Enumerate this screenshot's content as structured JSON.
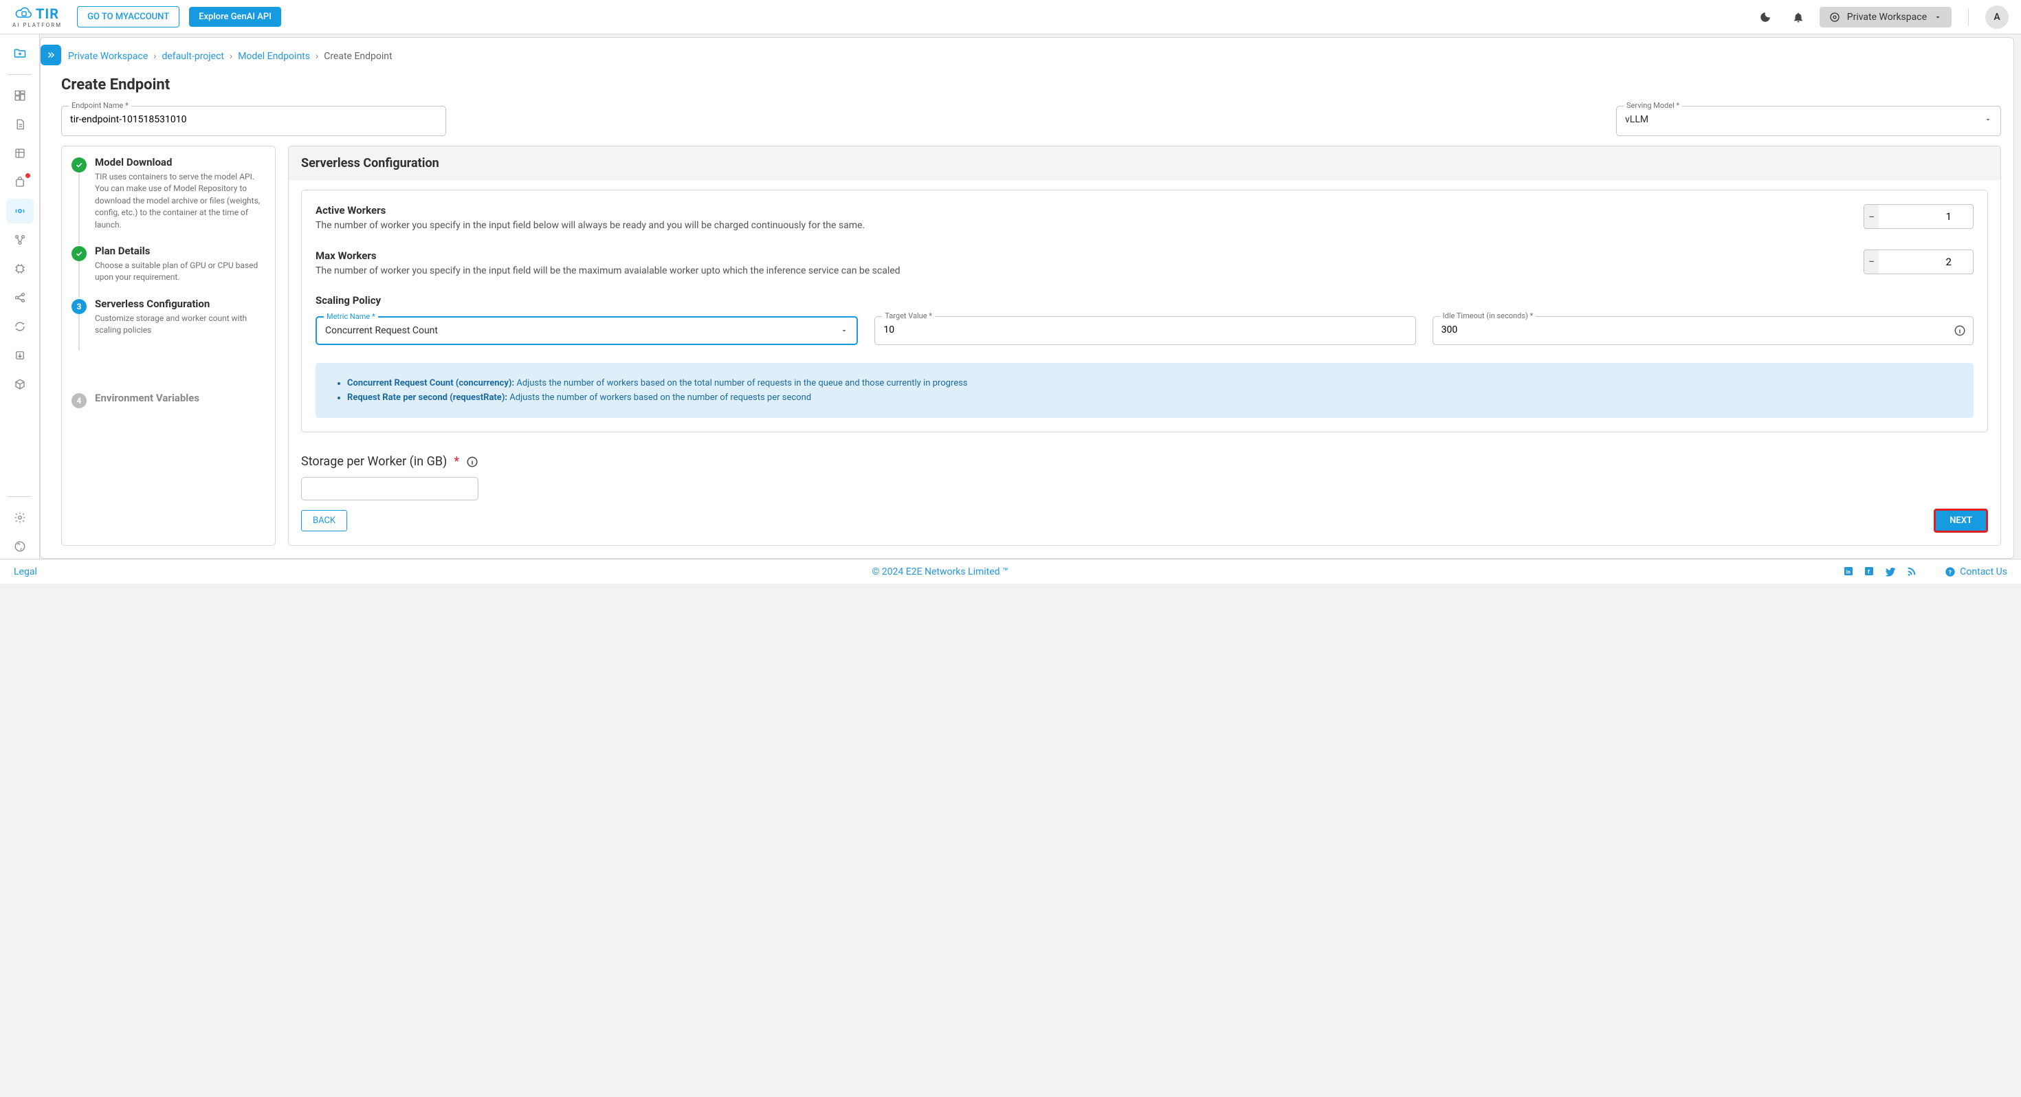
{
  "header": {
    "logo_text": "TIR",
    "logo_subtext": "AI PLATFORM",
    "myaccount_btn": "GO TO MYACCOUNT",
    "explore_btn": "Explore GenAI API",
    "workspace_label": "Private Workspace",
    "avatar_initial": "A"
  },
  "breadcrumb": {
    "items": [
      "Private Workspace",
      "default-project",
      "Model Endpoints"
    ],
    "current": "Create Endpoint"
  },
  "page_title": "Create Endpoint",
  "form": {
    "endpoint_name_label": "Endpoint Name *",
    "endpoint_name_value": "tir-endpoint-101518531010",
    "serving_model_label": "Serving Model *",
    "serving_model_value": "vLLM"
  },
  "stepper": [
    {
      "state": "done",
      "title": "Model Download",
      "desc": "TIR uses containers to serve the model API. You can make use of Model Repository to download the model archive or files (weights, config, etc.) to the container at the time of launch."
    },
    {
      "state": "done",
      "title": "Plan Details",
      "desc": "Choose a suitable plan of GPU or CPU based upon your requirement."
    },
    {
      "state": "active",
      "title": "Serverless Configuration",
      "num": "3",
      "desc": "Customize storage and worker count with scaling policies"
    },
    {
      "state": "pending",
      "title": "Environment Variables",
      "num": "4",
      "desc": ""
    }
  ],
  "config": {
    "heading": "Serverless Configuration",
    "active_workers": {
      "title": "Active Workers",
      "desc": "The number of worker you specify in the input field below will always be ready and you will be charged continuously for the same.",
      "value": "1"
    },
    "max_workers": {
      "title": "Max Workers",
      "desc": "The number of worker you specify in the input field will be the maximum avaialable worker upto which the inference service can be scaled",
      "value": "2"
    },
    "scaling_heading": "Scaling Policy",
    "metric_label": "Metric Name *",
    "metric_value": "Concurrent Request Count",
    "target_label": "Target Value *",
    "target_value": "10",
    "idle_label": "Idle Timeout (in seconds) *",
    "idle_value": "300",
    "note1_bold": "Concurrent Request Count (concurrency):",
    "note1_rest": " Adjusts the number of workers based on the total number of requests in the queue and those currently in progress",
    "note2_bold": "Request Rate per second (requestRate):",
    "note2_rest": " Adjusts the number of workers based on the number of requests per second",
    "storage_label": "Storage per Worker (in GB)",
    "back_btn": "BACK",
    "next_btn": "NEXT"
  },
  "footer": {
    "legal": "Legal",
    "copyright": "© 2024 E2E Networks Limited ™",
    "contact": "Contact Us"
  }
}
